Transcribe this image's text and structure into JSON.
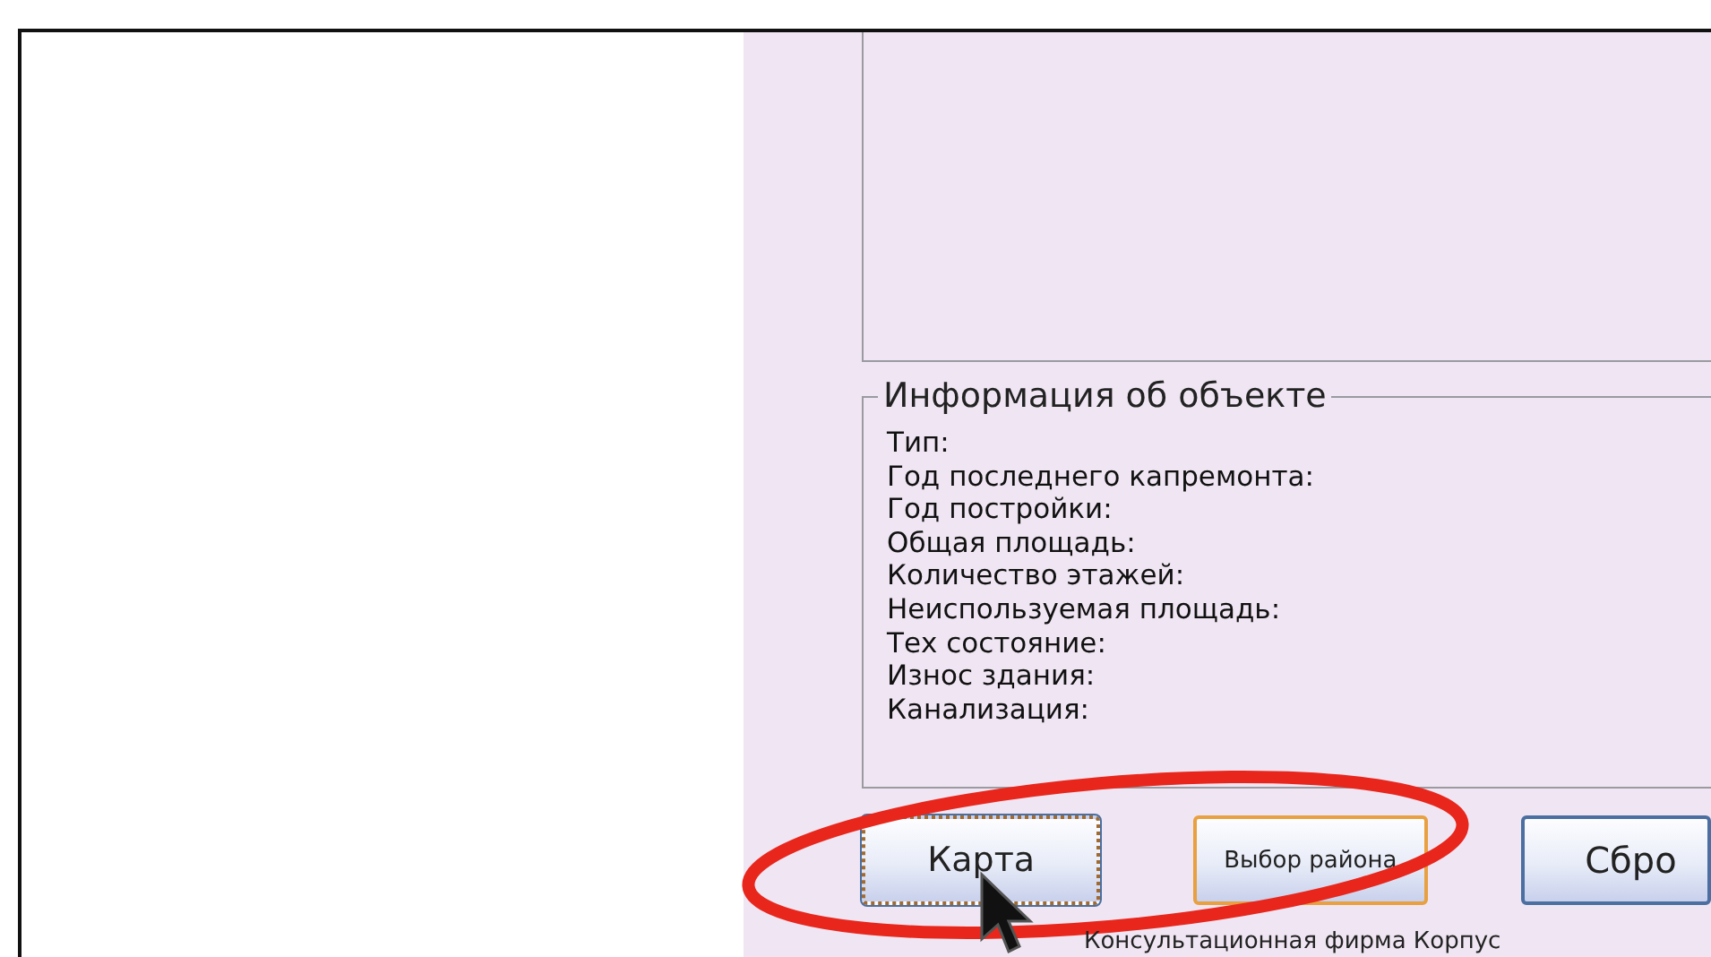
{
  "object_info": {
    "title": "Информация об объекте",
    "fields": [
      "Тип:",
      "Год последнего капремонта:",
      "Год постройки:",
      "Общая площадь:",
      "Количество этажей:",
      "Неиспользуемая площадь:",
      "Тех состояние:",
      "Износ здания:",
      "Канализация:"
    ]
  },
  "buttons": [
    {
      "label": "Карта",
      "focused": true,
      "hot": false
    },
    {
      "label": "Выбор района",
      "focused": false,
      "hot": true
    },
    {
      "label": "Сбро",
      "focused": false,
      "hot": false
    }
  ],
  "footer": "Консультационная фирма Корпус"
}
